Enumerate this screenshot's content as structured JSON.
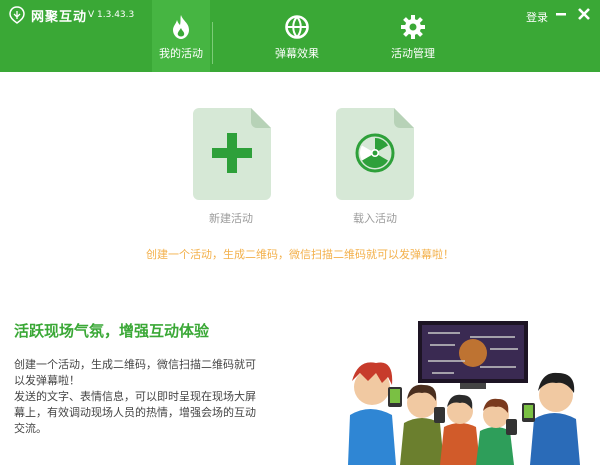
{
  "app": {
    "title": "网聚互动",
    "version": "V 1.3.43.3",
    "login_label": "登录"
  },
  "colors": {
    "brand": "#3aa836",
    "card_bg": "#d6e8d6",
    "accent_text": "#f3b04a"
  },
  "tabs": [
    {
      "label": "我的活动",
      "icon": "flame-icon",
      "active": true
    },
    {
      "label": "弹幕效果",
      "icon": "basketball-icon",
      "active": false
    },
    {
      "label": "活动管理",
      "icon": "gear-icon",
      "active": false
    }
  ],
  "actions": {
    "new_activity": {
      "label": "新建活动",
      "icon": "plus-icon"
    },
    "load_activity": {
      "label": "载入活动",
      "icon": "radiation-icon"
    }
  },
  "notice": "创建一个活动，生成二维码，微信扫描二维码就可以发弹幕啦！",
  "feature": {
    "title": "活跃现场气氛，增强互动体验",
    "line1": "创建一个活动，生成二维码，微信扫描二维码就可以发弹幕啦！",
    "line2": "发送的文字、表情信息，可以即时呈现在现场大屏幕上，有效调动现场人员的热情，增强会场的互动交流。"
  }
}
